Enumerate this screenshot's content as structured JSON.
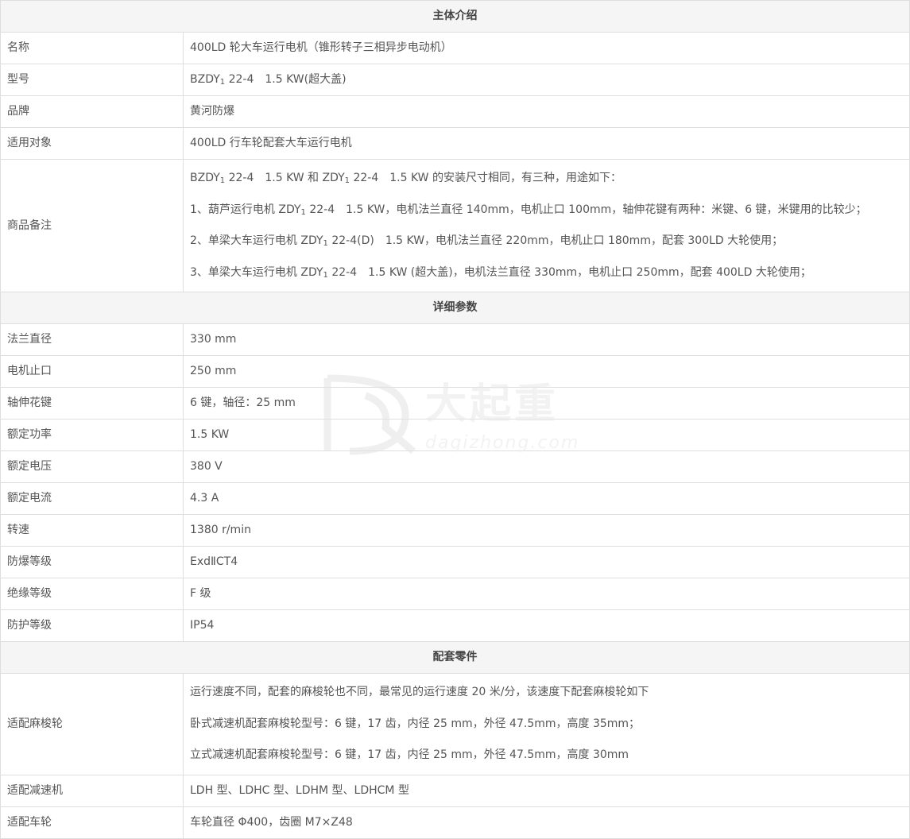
{
  "sections": {
    "intro": "主体介绍",
    "details": "详细参数",
    "parts": "配套零件"
  },
  "intro": {
    "name": {
      "label": "名称",
      "value": "400LD 轮大车运行电机（锥形转子三相异步电动机）"
    },
    "model": {
      "label": "型号",
      "pre": "BZDY",
      "sub": "1",
      "post": " 22-4　1.5 KW(超大盖)"
    },
    "brand": {
      "label": "品牌",
      "value": "黄河防爆"
    },
    "target": {
      "label": "适用对象",
      "value": "400LD 行车轮配套大车运行电机"
    },
    "remarks": {
      "label": "商品备注",
      "line1": {
        "a": "BZDY",
        "s1": "1",
        "b": " 22-4　1.5 KW 和 ZDY",
        "s2": "1",
        "c": " 22-4　1.5 KW 的安装尺寸相同，有三种，用途如下："
      },
      "line2": {
        "a": "1、葫芦运行电机 ZDY",
        "s": "1",
        "b": " 22-4　1.5 KW，电机法兰直径 140mm，电机止口 100mm，轴伸花键有两种：米键、6 键，米键用的比较少；"
      },
      "line3": {
        "a": "2、单梁大车运行电机 ZDY",
        "s": "1",
        "b": " 22-4(D)　1.5 KW，电机法兰直径 220mm，电机止口 180mm，配套 300LD 大轮使用；"
      },
      "line4": {
        "a": "3、单梁大车运行电机 ZDY",
        "s": "1",
        "b": " 22-4　1.5 KW (超大盖)，电机法兰直径 330mm，电机止口 250mm，配套 400LD 大轮使用；"
      }
    }
  },
  "details": [
    {
      "label": "法兰直径",
      "value": "330 mm"
    },
    {
      "label": "电机止口",
      "value": "250 mm"
    },
    {
      "label": "轴伸花键",
      "value": "6 键，轴径：25 mm"
    },
    {
      "label": "额定功率",
      "value": "1.5 KW"
    },
    {
      "label": "额定电压",
      "value": "380 V"
    },
    {
      "label": "额定电流",
      "value": "4.3 A"
    },
    {
      "label": "转速",
      "value": "1380 r/min"
    },
    {
      "label": "防爆等级",
      "value": "ExdⅡCT4"
    },
    {
      "label": "绝缘等级",
      "value": "F 级"
    },
    {
      "label": "防护等级",
      "value": "IP54"
    }
  ],
  "parts": {
    "gear": {
      "label": "适配麻梭轮",
      "lines": [
        "运行速度不同，配套的麻梭轮也不同，最常见的运行速度 20 米/分，该速度下配套麻梭轮如下",
        "卧式减速机配套麻梭轮型号：6 键，17 齿，内径 25 mm，外径 47.5mm，高度 35mm；",
        "立式减速机配套麻梭轮型号：6 键，17 齿，内径 25 mm，外径 47.5mm，高度 30mm"
      ]
    },
    "reducer": {
      "label": "适配减速机",
      "value": "LDH 型、LDHC 型、LDHM 型、LDHCM 型"
    },
    "wheel": {
      "label": "适配车轮",
      "value": "车轮直径 Φ400，齿圈 M7×Z48"
    }
  },
  "watermark": {
    "text_cn": "大起重",
    "text_en": "daqizhong.com",
    "logo": "DQ-logo-icon"
  }
}
